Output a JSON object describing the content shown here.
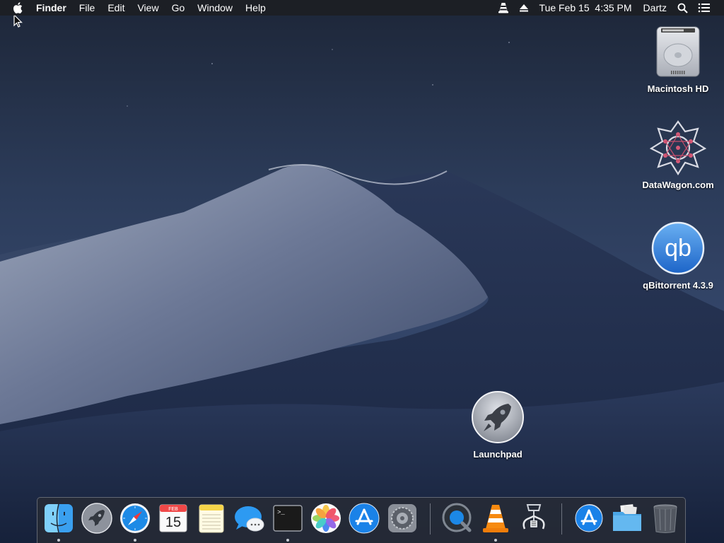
{
  "menubar": {
    "app_name": "Finder",
    "menus": [
      "File",
      "Edit",
      "View",
      "Go",
      "Window",
      "Help"
    ],
    "clock": "Tue Feb 15  4:35 PM",
    "user": "Dartz"
  },
  "desktop_icons": [
    {
      "label": "Macintosh HD",
      "icon": "hard-drive-icon"
    },
    {
      "label": "DataWagon.com",
      "icon": "datawagon-icon"
    },
    {
      "label": "qBittorrent 4.3.9",
      "icon": "qbittorrent-icon",
      "glyph": "qb"
    },
    {
      "label": "Launchpad",
      "icon": "launchpad-icon"
    }
  ],
  "dock": {
    "items": [
      {
        "name": "finder",
        "icon": "finder-icon",
        "running": true
      },
      {
        "name": "launchpad",
        "icon": "launchpad-icon",
        "running": false
      },
      {
        "name": "safari",
        "icon": "safari-icon",
        "running": true
      },
      {
        "name": "calendar",
        "icon": "calendar-icon",
        "running": false,
        "month": "FEB",
        "day": "15"
      },
      {
        "name": "notes",
        "icon": "notes-icon",
        "running": false
      },
      {
        "name": "messages",
        "icon": "messages-icon",
        "running": false
      },
      {
        "name": "terminal",
        "icon": "terminal-icon",
        "running": true,
        "prompt": ">_"
      },
      {
        "name": "photos",
        "icon": "photos-icon",
        "running": false
      },
      {
        "name": "app-store",
        "icon": "app-store-icon",
        "running": false
      },
      {
        "name": "system-preferences",
        "icon": "system-preferences-icon",
        "running": false
      },
      {
        "name": "quicktime",
        "icon": "quicktime-icon",
        "running": false
      },
      {
        "name": "vlc",
        "icon": "vlc-icon",
        "running": true
      },
      {
        "name": "archive-utility",
        "icon": "archive-utility-icon",
        "running": false
      },
      {
        "name": "applications-folder",
        "icon": "applications-folder-icon",
        "running": false
      },
      {
        "name": "downloads-folder",
        "icon": "downloads-folder-icon",
        "running": false
      },
      {
        "name": "trash",
        "icon": "trash-icon",
        "running": false
      }
    ]
  },
  "colors": {
    "accent_blue": "#1a82e8",
    "menubar_bg": "#1c1e24",
    "dock_bg": "#282c34"
  }
}
